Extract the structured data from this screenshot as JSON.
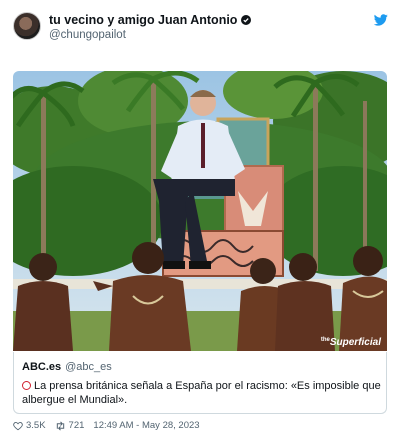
{
  "author": {
    "display_name": "tu vecino y amigo Juan Antonio",
    "handle": "@chungopailot"
  },
  "media": {
    "watermark_prefix": "the",
    "watermark": "Superficial"
  },
  "quote": {
    "name": "ABC.es",
    "handle": "@abc_es",
    "text": "La prensa británica señala a España por el racismo: «Es imposible que albergue el Mundial»."
  },
  "footer": {
    "likes": "3.5K",
    "retweets": "721",
    "timestamp": "12:49 AM - May 28, 2023"
  },
  "colors": {
    "twitter_blue": "#1d9bf0",
    "circle_red": "#d0202f"
  }
}
